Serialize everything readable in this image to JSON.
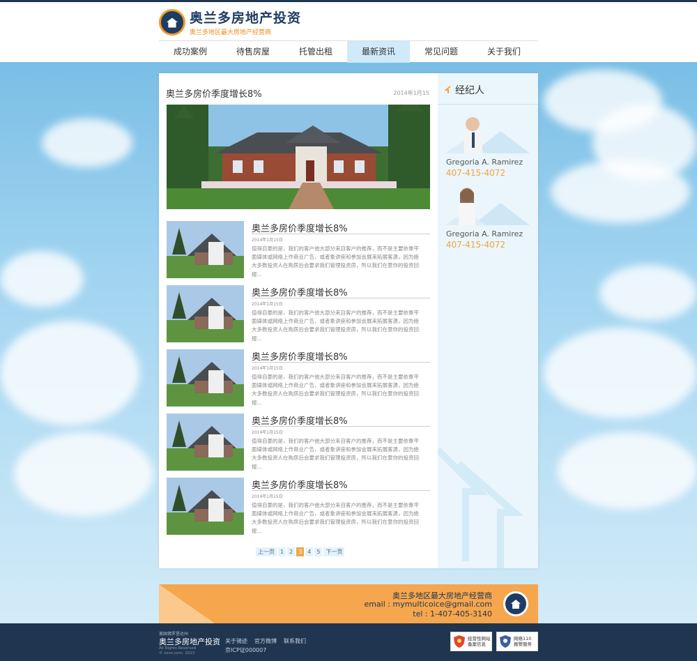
{
  "header": {
    "brand_title": "奥兰多房地产投资",
    "brand_sub": "奥兰多地区最大房地产经营商"
  },
  "nav": [
    {
      "label": "成功案例"
    },
    {
      "label": "待售房屋"
    },
    {
      "label": "托管出租"
    },
    {
      "label": "最新资讯",
      "active": true
    },
    {
      "label": "常见问题"
    },
    {
      "label": "关于我们"
    }
  ],
  "article": {
    "title": "奥兰多房价季度增长8%",
    "date": "2014年1月15"
  },
  "news": [
    {
      "title": "奥兰多房价季度增长8%",
      "date": "2014年1月15日",
      "desc": "值得自豪的是，我们的客户他大部分来自客户的推荐，而不是主要依靠平面媒体或网络上作商业广告，或者象讲座和参加会展来拓展客源，因为绝大多数投资人在购房后会要求我们管理投资房，所以我们在意你的投资回报..."
    },
    {
      "title": "奥兰多房价季度增长8%",
      "date": "2014年1月15日",
      "desc": "值得自豪的是，我们的客户他大部分来自客户的推荐，而不是主要依靠平面媒体或网络上作商业广告，或者象讲座和参加会展来拓展客源，因为绝大多数投资人在购房后会要求我们管理投资房，所以我们在意你的投资回报..."
    },
    {
      "title": "奥兰多房价季度增长8%",
      "date": "2014年1月15日",
      "desc": "值得自豪的是，我们的客户他大部分来自客户的推荐，而不是主要依靠平面媒体或网络上作商业广告，或者象讲座和参加会展来拓展客源，因为绝大多数投资人在购房后会要求我们管理投资房，所以我们在意你的投资回报..."
    },
    {
      "title": "奥兰多房价季度增长8%",
      "date": "2014年1月15日",
      "desc": "值得自豪的是，我们的客户他大部分来自客户的推荐，而不是主要依靠平面媒体或网络上作商业广告，或者象讲座和参加会展来拓展客源，因为绝大多数投资人在购房后会要求我们管理投资房，所以我们在意你的投资回报..."
    },
    {
      "title": "奥兰多房价季度增长8%",
      "date": "2014年1月15日",
      "desc": "值得自豪的是，我们的客户他大部分来自客户的推荐，而不是主要依靠平面媒体或网络上作商业广告，或者象讲座和参加会展来拓展客源，因为绝大多数投资人在购房后会要求我们管理投资房，所以我们在意你的投资回报..."
    }
  ],
  "pager": {
    "prev": "上一页",
    "pages": [
      "1",
      "2",
      "3",
      "4",
      "5"
    ],
    "current": "3",
    "next": "下一页"
  },
  "sidebar": {
    "heading": "经纪人",
    "agents": [
      {
        "name": "Gregoria A. Ramirez",
        "phone": "407-415-4072"
      },
      {
        "name": "Gregoria A. Ramirez",
        "phone": "407-415-4072"
      }
    ]
  },
  "footer_band": {
    "line1": "奥兰多地区最大房地产经营商",
    "line2": "email : mymulticoice@gmail.com",
    "line3": "tel : 1-407-405-3140"
  },
  "footer": {
    "small": "美国佛罗里达州",
    "brand": "奥兰多房地产投资",
    "rights1": "All Rights Reserved",
    "rights2": "© xxxx.com, 2013",
    "links": [
      "关于骑迹",
      "官方微博",
      "联系我们"
    ],
    "icp": "京ICP证000007",
    "badge1_line1": "经营性网站",
    "badge1_line2": "备案信息",
    "badge2_line1": "网络110",
    "badge2_line2": "报警服务"
  },
  "colors": {
    "navy": "#1f3550",
    "orange": "#f6a64d",
    "phone_orange": "#f5a23c",
    "nav_active": "#cfeaf8"
  }
}
